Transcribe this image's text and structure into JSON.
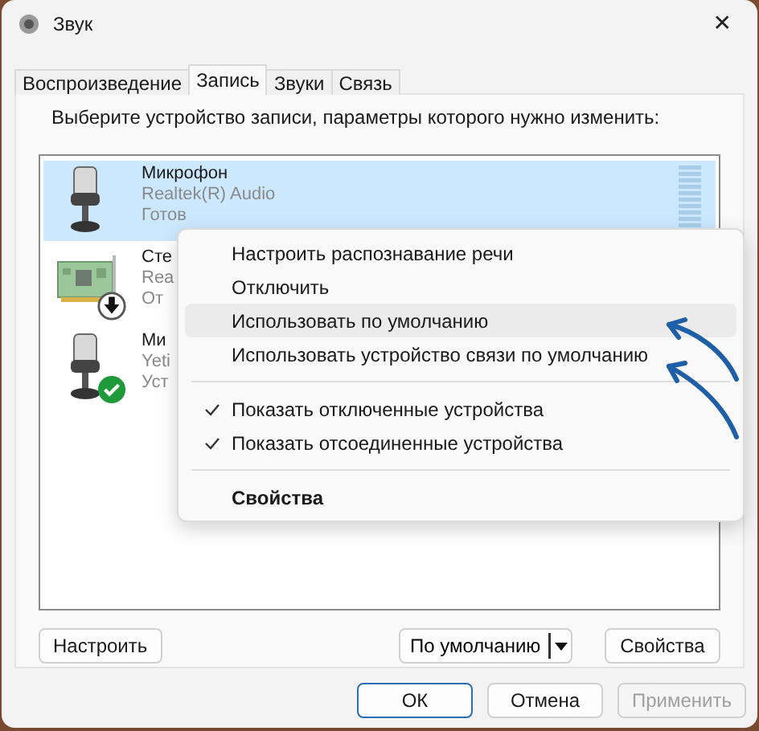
{
  "window": {
    "title": "Звук",
    "close": "✕"
  },
  "tabs": [
    {
      "label": "Воспроизведение",
      "selected": false
    },
    {
      "label": "Запись",
      "selected": true
    },
    {
      "label": "Звуки",
      "selected": false
    },
    {
      "label": "Связь",
      "selected": false
    }
  ],
  "instruction": "Выберите устройство записи, параметры которого нужно изменить:",
  "devices": [
    {
      "kind": "microphone",
      "disabled": false,
      "default": false,
      "selected": true,
      "name": "Микрофон",
      "driver": "Realtek(R) Audio",
      "status": "Готов"
    },
    {
      "kind": "card",
      "disabled": true,
      "default": false,
      "selected": false,
      "name": "Сте",
      "driver": "Rea",
      "status": "От"
    },
    {
      "kind": "microphone",
      "disabled": false,
      "default": true,
      "selected": false,
      "name": "Ми",
      "driver": "Yeti",
      "status": "Уст"
    }
  ],
  "context_menu": [
    {
      "kind": "item",
      "label": "Настроить распознавание речи",
      "highlighted": false
    },
    {
      "kind": "item",
      "label": "Отключить",
      "highlighted": false
    },
    {
      "kind": "item",
      "label": "Использовать по умолчанию",
      "highlighted": true
    },
    {
      "kind": "item",
      "label": "Использовать устройство связи по умолчанию",
      "highlighted": false
    },
    {
      "kind": "separator"
    },
    {
      "kind": "check",
      "label": "Показать отключенные устройства",
      "checked": true,
      "highlighted": false
    },
    {
      "kind": "check",
      "label": "Показать отсоединенные устройства",
      "checked": true,
      "highlighted": false
    },
    {
      "kind": "separator"
    },
    {
      "kind": "default",
      "label": "Свойства",
      "highlighted": false
    }
  ],
  "panel_buttons": {
    "configure": "Настроить",
    "default_split": "По умолчанию",
    "properties": "Свойства"
  },
  "footer_buttons": [
    {
      "label": "ОК",
      "kind": "primary"
    },
    {
      "label": "Отмена",
      "kind": "normal"
    },
    {
      "label": "Применить",
      "kind": "disabled"
    }
  ]
}
